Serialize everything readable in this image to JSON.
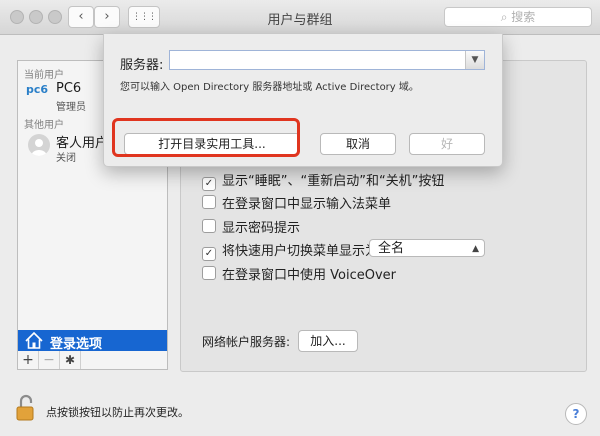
{
  "window": {
    "title": "用户与群组",
    "search_placeholder": "搜索",
    "nav_back": "‹",
    "nav_forward": "›",
    "grid": "⋮⋮⋮"
  },
  "sidebar": {
    "current_users_label": "当前用户",
    "current_user": {
      "avatar_text": "pc6",
      "name": "PC6",
      "role": "管理员"
    },
    "other_users_label": "其他用户",
    "guest_user": {
      "name": "客人用户",
      "status": "关闭"
    },
    "login_options_label": "登录选项",
    "tools": {
      "add": "+",
      "remove": "−",
      "gear": "✱"
    }
  },
  "options": [
    {
      "label": "显示“睡眠”、“重新启动”和“关机”按钮",
      "checked": true
    },
    {
      "label": "在登录窗口中显示输入法菜单",
      "checked": false
    },
    {
      "label": "显示密码提示",
      "checked": false
    },
    {
      "label": "将快速用户切换菜单显示为",
      "checked": true
    },
    {
      "label": "在登录窗口中使用 VoiceOver",
      "checked": false
    }
  ],
  "fast_switch_value": "全名",
  "network_account_label": "网络帐户服务器:",
  "join_button": "加入...",
  "lock_text": "点按锁按钮以防止再次更改。",
  "help": "?",
  "sheet": {
    "server_label": "服务器:",
    "server_value": "",
    "hint": "您可以输入 Open Directory 服务器地址或 Active Directory 域。",
    "open_utility_button": "打开目录实用工具...",
    "cancel_button": "取消",
    "ok_button": "好"
  },
  "colors": {
    "accent": "#1766d1",
    "highlight": "#e0351f"
  }
}
